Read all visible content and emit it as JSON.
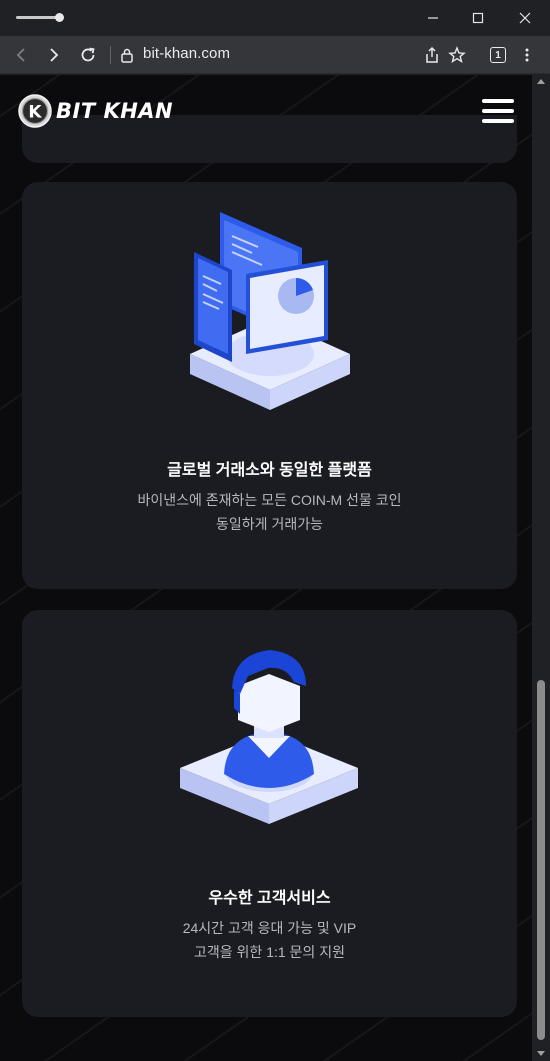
{
  "browser": {
    "url": "bit-khan.com",
    "tab_count": "1"
  },
  "site": {
    "logo_text": "BIT KHAN",
    "logo_letter": "K"
  },
  "cards": [
    {
      "title": "글로벌 거래소와 동일한 플랫폼",
      "desc_line1": "바이낸스에 존재하는 모든 COIN-M 선물 코인",
      "desc_line2": "동일하게 거래가능",
      "icon": "platform-screens-icon"
    },
    {
      "title": "우수한 고객서비스",
      "desc_line1": "24시간 고객 응대 가능 및 VIP",
      "desc_line2": "고객을 위한 1:1 문의 지원",
      "icon": "customer-service-icon"
    }
  ],
  "colors": {
    "accent_blue": "#2f5bea",
    "card_bg": "#1b1c22",
    "page_bg": "#0b0b0d"
  }
}
